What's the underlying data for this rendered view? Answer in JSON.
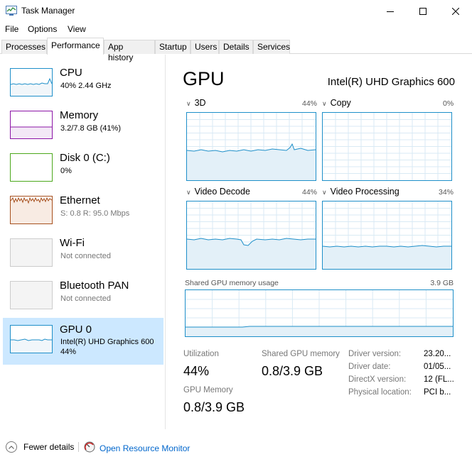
{
  "window": {
    "title": "Task Manager",
    "menu": [
      "File",
      "Options",
      "View"
    ],
    "tabs": [
      "Processes",
      "Performance",
      "App history",
      "Startup",
      "Users",
      "Details",
      "Services"
    ],
    "active_tab": "Performance"
  },
  "sidebar": {
    "items": [
      {
        "name": "CPU",
        "sub": "40%  2.44 GHz",
        "color": "#1e8fc9"
      },
      {
        "name": "Memory",
        "sub": "3.2/7.8 GB (41%)",
        "color": "#8b14a6"
      },
      {
        "name": "Disk 0 (C:)",
        "sub": "0%",
        "color": "#4ca81c"
      },
      {
        "name": "Ethernet",
        "sub": "S: 0.8  R: 95.0 Mbps",
        "color": "#a7501e"
      },
      {
        "name": "Wi-Fi",
        "sub": "Not connected",
        "color": "#bbbbbb"
      },
      {
        "name": "Bluetooth PAN",
        "sub": "Not connected",
        "color": "#bbbbbb"
      },
      {
        "name": "GPU 0",
        "sub": "Intel(R) UHD Graphics 600",
        "sub2": "44%",
        "color": "#1e8fc9"
      }
    ],
    "selected": "GPU 0"
  },
  "main": {
    "title": "GPU",
    "model": "Intel(R) UHD Graphics 600",
    "graphs": [
      {
        "label": "3D",
        "pct": "44%"
      },
      {
        "label": "Copy",
        "pct": "0%"
      },
      {
        "label": "Video Decode",
        "pct": "44%"
      },
      {
        "label": "Video Processing",
        "pct": "34%"
      }
    ],
    "shared_memory_label": "Shared GPU memory usage",
    "shared_memory_max": "3.9 GB",
    "stats": {
      "utilization_label": "Utilization",
      "utilization_value": "44%",
      "shared_label": "Shared GPU memory",
      "shared_value": "0.8/3.9 GB",
      "gpu_memory_label": "GPU Memory",
      "gpu_memory_value": "0.8/3.9 GB"
    },
    "info": [
      {
        "label": "Driver version:",
        "value": "23.20..."
      },
      {
        "label": "Driver date:",
        "value": "01/05..."
      },
      {
        "label": "DirectX version:",
        "value": "12 (FL..."
      },
      {
        "label": "Physical location:",
        "value": "PCI b..."
      }
    ]
  },
  "footer": {
    "fewer_details": "Fewer details",
    "open_monitor": "Open Resource Monitor"
  },
  "colors": {
    "gpu_accent": "#1e8fc9",
    "selected_bg": "#cce8ff",
    "link": "#0066cc"
  }
}
